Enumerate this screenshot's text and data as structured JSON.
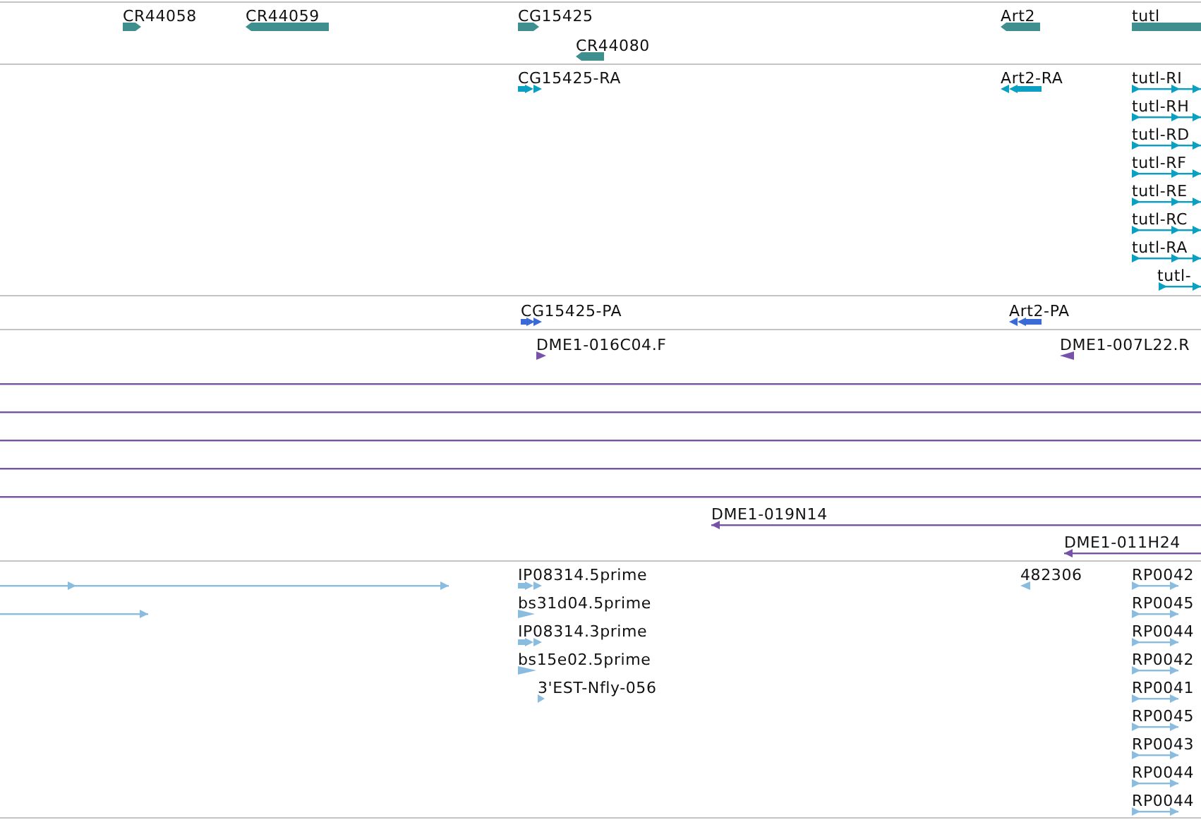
{
  "tracks": [
    {
      "features": [
        {
          "label": "CR44058",
          "kind": "block",
          "reverse": false
        },
        {
          "label": "CR44059",
          "kind": "block",
          "reverse": true
        },
        {
          "label": "CG15425",
          "kind": "block",
          "reverse": false
        },
        {
          "label": "CR44080",
          "kind": "block",
          "reverse": true
        },
        {
          "label": "Art2",
          "kind": "block",
          "reverse": true
        },
        {
          "label": "tutl",
          "kind": "bar"
        }
      ]
    },
    {
      "features": [
        {
          "label": "CG15425-RA",
          "kind": "double",
          "reverse": false
        },
        {
          "label": "Art2-RA",
          "kind": "double",
          "reverse": true
        },
        {
          "label": "tutl-RI",
          "kind": "line",
          "reverse": false
        },
        {
          "label": "tutl-RH",
          "kind": "line",
          "reverse": false
        },
        {
          "label": "tutl-RD",
          "kind": "line",
          "reverse": false
        },
        {
          "label": "tutl-RF",
          "kind": "line",
          "reverse": false
        },
        {
          "label": "tutl-RE",
          "kind": "line",
          "reverse": false
        },
        {
          "label": "tutl-RC",
          "kind": "line",
          "reverse": false
        },
        {
          "label": "tutl-RA",
          "kind": "line",
          "reverse": false
        },
        {
          "label": "tutl-",
          "kind": "line",
          "reverse": false
        }
      ]
    },
    {
      "features": [
        {
          "label": "CG15425-PA",
          "kind": "double",
          "reverse": false
        },
        {
          "label": "Art2-PA",
          "kind": "double",
          "reverse": true
        }
      ]
    },
    {
      "features": [
        {
          "label": "DME1-016C04.F",
          "kind": "tick",
          "reverse": false
        },
        {
          "label": "DME1-007L22.R",
          "kind": "tick",
          "reverse": true
        },
        {
          "kind": "plain"
        },
        {
          "kind": "plain"
        },
        {
          "kind": "plain"
        },
        {
          "kind": "plain"
        },
        {
          "kind": "plain"
        },
        {
          "label": "DME1-019N14",
          "kind": "lineend",
          "reverse": true
        },
        {
          "label": "DME1-011H24",
          "kind": "lineend",
          "reverse": true
        }
      ]
    },
    {
      "features": [
        {
          "kind": "line",
          "reverse": false
        },
        {
          "kind": "line",
          "reverse": false
        },
        {
          "label": "IP08314.5prime",
          "kind": "double",
          "reverse": false
        },
        {
          "label": "bs31d04.5prime",
          "kind": "tick",
          "reverse": false
        },
        {
          "label": "IP08314.3prime",
          "kind": "double",
          "reverse": false
        },
        {
          "label": "bs15e02.5prime",
          "kind": "tick",
          "reverse": false
        },
        {
          "label": "3'EST-Nfly-056",
          "kind": "tick",
          "reverse": false
        },
        {
          "label": "482306",
          "kind": "tick",
          "reverse": true
        },
        {
          "label": "RP0042",
          "kind": "line",
          "reverse": false
        },
        {
          "label": "RP0045",
          "kind": "line",
          "reverse": false
        },
        {
          "label": "RP0044",
          "kind": "line",
          "reverse": false
        },
        {
          "label": "RP0042",
          "kind": "line",
          "reverse": false
        },
        {
          "label": "RP0041",
          "kind": "line",
          "reverse": false
        },
        {
          "label": "RP0045",
          "kind": "line",
          "reverse": false
        },
        {
          "label": "RP0043",
          "kind": "line",
          "reverse": false
        },
        {
          "label": "RP0044",
          "kind": "line",
          "reverse": false
        },
        {
          "label": "RP0044",
          "kind": "line",
          "reverse": false
        }
      ]
    }
  ]
}
